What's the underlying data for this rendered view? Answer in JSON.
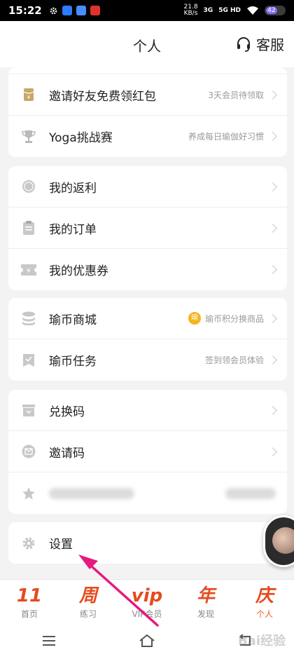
{
  "status": {
    "time": "15:22",
    "speed_top": "21.8",
    "speed_bottom": "KB/s",
    "net1": "3G",
    "net2": "5G HD",
    "battery": "42"
  },
  "header": {
    "title": "个人",
    "service": "客服"
  },
  "cards": {
    "group0": [
      {
        "label": "邀请好友免费领红包",
        "hint": "3天会员待领取"
      },
      {
        "label": "Yoga挑战赛",
        "hint": "养成每日瑜伽好习惯"
      }
    ],
    "group1": [
      {
        "label": "我的返利"
      },
      {
        "label": "我的订单"
      },
      {
        "label": "我的优惠券"
      }
    ],
    "group2": [
      {
        "label": "瑜币商城",
        "coin": "瑜",
        "hint": "瑜币积分换商品"
      },
      {
        "label": "瑜币任务",
        "hint": "签到领会员体验"
      }
    ],
    "group3": [
      {
        "label": "兑换码"
      },
      {
        "label": "邀请码"
      }
    ],
    "group4": [
      {
        "label": "设置"
      }
    ]
  },
  "tabs": [
    {
      "glyph": "11",
      "label": "首页"
    },
    {
      "glyph": "周",
      "label": "练习"
    },
    {
      "glyph": "vip",
      "label": "VIP会员"
    },
    {
      "glyph": "年",
      "label": "发现"
    },
    {
      "glyph": "庆",
      "label": "个人"
    }
  ],
  "watermark": "Bai经验",
  "colors": {
    "accent": "#ff5a1e",
    "arrow": "#e6197e",
    "coin": "#f5b41e"
  }
}
